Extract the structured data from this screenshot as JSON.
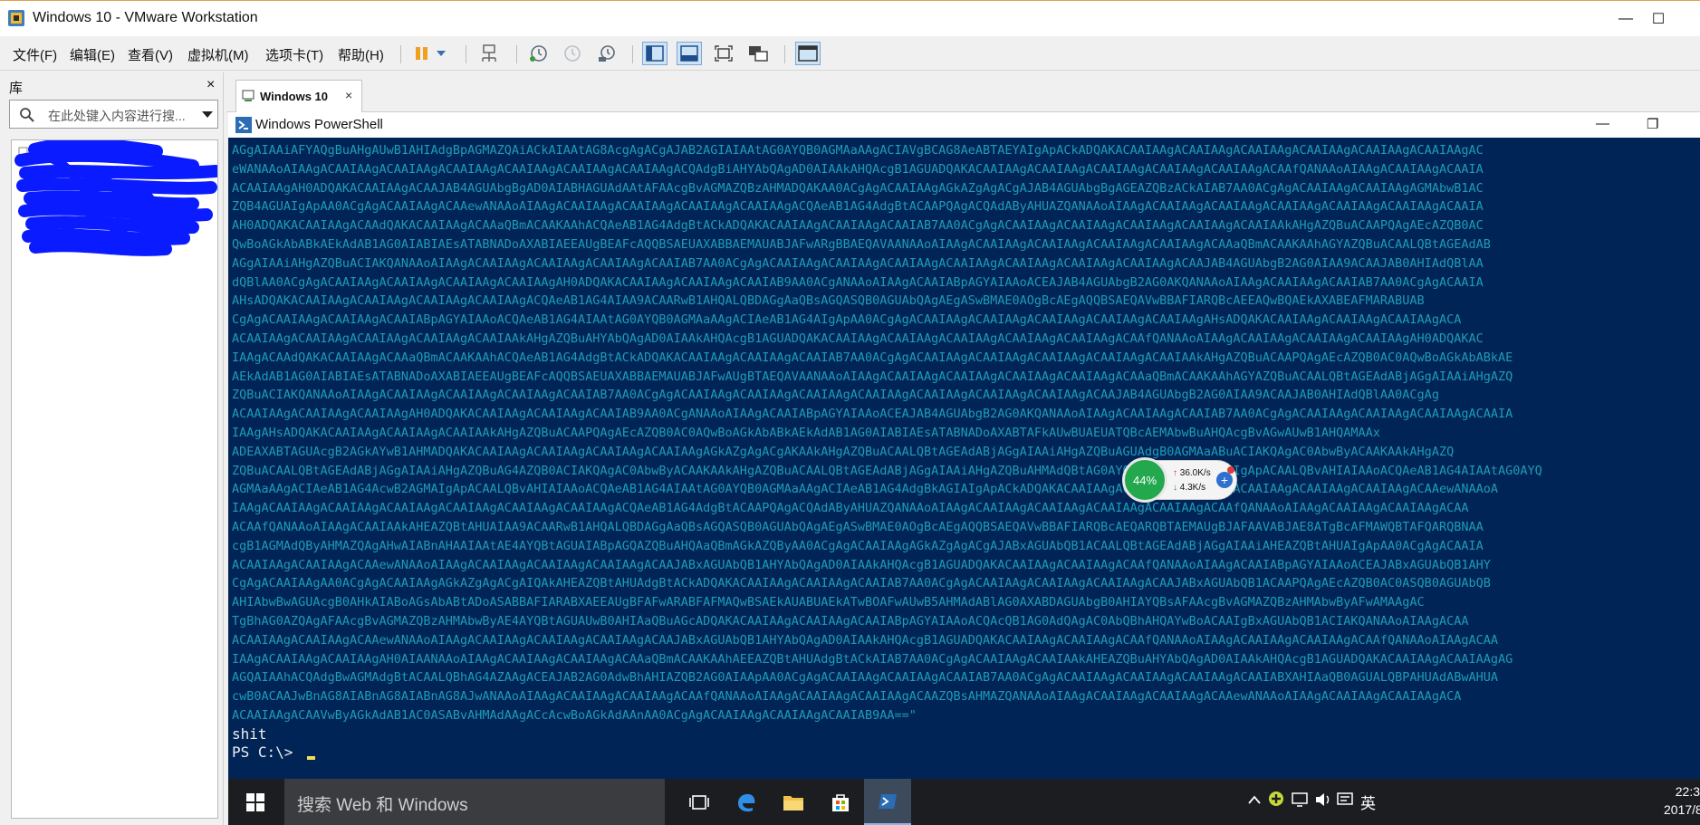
{
  "window": {
    "title": "Windows 10 - VMware Workstation",
    "minimize_glyph": "—",
    "maximize_glyph": "☐"
  },
  "menu": {
    "items": [
      "文件(F)",
      "编辑(E)",
      "查看(V)",
      "虚拟机(M)",
      "选项卡(T)",
      "帮助(H)"
    ]
  },
  "library": {
    "title": "库",
    "close_glyph": "×",
    "search_placeholder": "在此处键入内容进行搜..."
  },
  "vm_tab": {
    "label": "Windows 10",
    "close_glyph": "×"
  },
  "powershell": {
    "title": "Windows PowerShell",
    "minimize_glyph": "—",
    "restore_glyph": "❐",
    "base64_lines": [
      "AGgAIAAiAFYAQgBuAHgAUwB1AHIAdgBpAGMAZQAiACkAIAAtAG8AcgAgACgAJAB2AGIAIAAtAG0AYQB0AGMAaAAgACIAVgBCAG8AeABTAEYAIgApACkADQAKACAAIAAgACAAIAAgACAAIAAgACAAIAAgACAAIAAgACAAIAAgAC",
      "eWANAAoAIAAgACAAIAAgACAAIAAgACAAIAAgACAAIAAgACAAIAAgACAAIAAgACQAdgBiAHYAbQAgAD0AIAAkAHQAcgB1AGUADQAKACAAIAAgACAAIAAgACAAIAAgACAAIAAgACAAIAAgACAAfQANAAoAIAAgACAAIAAgACAAIA",
      "ACAAIAAgAH0ADQAKACAAIAAgACAAJAB4AGUAbgBgAD0AIABHAGUAdAAtAFAAcgBvAGMAZQBzAHMADQAKAA0ACgAgACAAIAAgAGkAZgAgACgAJAB4AGUAbgBgAGEAZQBzACkAIAB7AA0ACgAgACAAIAAgACAAIAAgAGMAbwB1AC",
      "ZQB4AGUAIgApAA0ACgAgACAAIAAgACAAewANAAoAIAAgACAAIAAgACAAIAAgACAAIAAgACAAIAAgACQAeAB1AG4AdgBtACAAPQAgACQAdAByAHUAZQANAAoAIAAgACAAIAAgACAAIAAgACAAIAAgACAAIAAgACAAIAAgACAAIA",
      "AH0ADQAKACAAIAAgACAAdQAKACAAIAAgACAAaQBmACAAKAAhACQAeAB1AG4AdgBtACkADQAKACAAIAAgACAAIAAgACAAIAB7AA0ACgAgACAAIAAgACAAIAAgACAAIAAgACAAIAAgACAAIAAkAHgAZQBuACAAPQAgAEcAZQB0AC",
      "QwBoAGkAbABkAEkAdAB1AG0AIABIAEsATABNADoAXABIAEEAUgBEAFcAQQBSAEUAXABBAEMAUABJAFwARgBBAEQAVAANAAoAIAAgACAAIAAgACAAIAAgACAAIAAgACAAIAAgACAAaQBmACAAKAAhAGYAZQBuACAALQBtAGEAdAB",
      "AGgAIAAiAHgAZQBuACIAKQANAAoAIAAgACAAIAAgACAAIAAgACAAIAAgACAAIAB7AA0ACgAgACAAIAAgACAAIAAgACAAIAAgACAAIAAgACAAIAAgACAAIAAgACAAIAAgACAAJAB4AGUAbgB2AG0AIAA9ACAAJAB0AHIAdQBlAA",
      "dQBlAA0ACgAgACAAIAAgACAAIAAgACAAIAAgACAAIAAgAH0ADQAKACAAIAAgACAAIAAgACAAIAB9AA0ACgANAAoAIAAgACAAIABpAGYAIAAoACEAJAB4AGUAbgB2AG0AKQANAAoAIAAgACAAIAAgACAAIAB7AA0ACgAgACAAIA",
      "AHsADQAKACAAIAAgACAAIAAgACAAIAAgACAAIAAgACQAeAB1AG4AIAA9ACAARwB1AHQALQBDAGgAaQBsAGQASQB0AGUAbQAgAEgASwBMAE0AOgBcAEgAQQBSAEQAVwBBAFIARQBcAEEAQwBQAEkAXABEAFMARABUAB",
      "CgAgACAAIAAgACAAIAAgACAAIABpAGYAIAAoACQAeAB1AG4AIAAtAG0AYQB0AGMAaAAgACIAeAB1AG4AIgApAA0ACgAgACAAIAAgACAAIAAgACAAIAAgACAAIAAgACAAIAAgAHsADQAKACAAIAAgACAAIAAgACAAIAAgACA",
      "ACAAIAAgACAAIAAgACAAIAAgACAAIAAgACAAIAAkAHgAZQBuAHYAbQAgAD0AIAAkAHQAcgB1AGUADQAKACAAIAAgACAAIAAgACAAIAAgACAAIAAgACAAIAAgACAAfQANAAoAIAAgACAAIAAgACAAIAAgACAAIAAgAH0ADQAKAC",
      "IAAgACAAdQAKACAAIAAgACAAaQBmACAAKAAhACQAeAB1AG4AdgBtACkADQAKACAAIAAgACAAIAAgACAAIAB7AA0ACgAgACAAIAAgACAAIAAgACAAIAAgACAAIAAgACAAIAAkAHgAZQBuACAAPQAgAEcAZQB0AC0AQwBoAGkAbABkAE",
      "AEkAdAB1AG0AIABIAEsATABNADoAXABIAEEAUgBEAFcAQQBSAEUAXABBAEMAUABJAFwAUgBTAEQAVAANAAoAIAAgACAAIAAgACAAIAAgACAAIAAgACAAIAAgACAAaQBmACAAKAAhAGYAZQBuACAALQBtAGEAdABjAGgAIAAiAHgAZQ",
      "ZQBuACIAKQANAAoAIAAgACAAIAAgACAAIAAgACAAIAAgACAAIAB7AA0ACgAgACAAIAAgACAAIAAgACAAIAAgACAAIAAgACAAIAAgACAAIAAgACAAIAAgACAAJAB4AGUAbgB2AG0AIAA9ACAAJAB0AHIAdQBlAA0ACgAg",
      "ACAAIAAgACAAIAAgACAAIAAgAH0ADQAKACAAIAAgACAAIAAgACAAIAB9AA0ACgANAAoAIAAgACAAIABpAGYAIAAoACEAJAB4AGUAbgB2AG0AKQANAAoAIAAgACAAIAAgACAAIAB7AA0ACgAgACAAIAAgACAAIAAgACAAIAAgACAAIA",
      "IAAgAHsADQAKACAAIAAgACAAIAAgACAAIAAkAHgAZQBuACAAPQAgAEcAZQB0AC0AQwBoAGkAbABkAEkAdAB1AG0AIABIAEsATABNADoAXABTAFkAUwBUAEUATQBcAEMAbwBuAHQAcgBvAGwAUwB1AHQAMAAx",
      "ADEAXABTAGUAcgB2AGkAYwB1AHMADQAKACAAIAAgACAAIAAgACAAIAAgACAAIAAgAGkAZgAgACgAKAAkAHgAZQBuACAALQBtAGEAdABjAGgAIAAiAHgAZQBuAGUAdgB0AGMAaABuACIAKQAgAC0AbwByACAAKAAkAHgAZQ",
      "ZQBuACAALQBtAGEAdABjAGgAIAAiAHgAZQBuAG4AZQB0ACIAKQAgAC0AbwByACAAKAAkAHgAZQBuACAALQBtAGEAdABjAGgAIAAiAHgAZQBuAHMAdQBtAG0AYQByAGUAbgB0ADYAIgApACAALQBvAHIAIAAoACQAeAB1AG4AIAAtAG0AYQ",
      "AGMAaAAgACIAeAB1AG4AcwB2AGMAIgApACAALQBvAHIAIAAoACQAeAB1AG4AIAAtAG0AYQB0AGMAaAAgACIAeAB1AG4AdgBkAGIAIgApACkADQAKACAAIAAgACAAIAAgACAAIAAgACAAIAAgACAAIAAgACAAIAAgACAAewANAAoA",
      "IAAgACAAIAAgACAAIAAgACAAIAAgACAAIAAgACAAIAAgACAAIAAgACQAeAB1AG4AdgBtACAAPQAgACQAdAByAHUAZQANAAoAIAAgACAAIAAgACAAIAAgACAAIAAgACAAIAAgACAAfQANAAoAIAAgACAAIAAgACAAIAAgACAA",
      "ACAAfQANAAoAIAAgACAAIAAkAHEAZQBtAHUAIAA9ACAARwB1AHQALQBDAGgAaQBsAGQASQB0AGUAbQAgAEgASwBMAE0AOgBcAEgAQQBSAEQAVwBBAFIARQBcAEQARQBTAEMAUgBJAFAAVABJAE8ATgBcAFMAWQBTAFQARQBNAA",
      "cgB1AGMAdQByAHMAZQAgAHwAIABnAHAAIAAtAE4AYQBtAGUAIABpAGQAZQBuAHQAaQBmAGkAZQByAA0ACgAgACAAIAAgAGkAZgAgACgAJABxAGUAbQB1ACAALQBtAGEAdABjAGgAIAAiAHEAZQBtAHUAIgApAA0ACgAgACAAIA",
      "ACAAIAAgACAAIAAgACAAewANAAoAIAAgACAAIAAgACAAIAAgACAAIAAgACAAJABxAGUAbQB1AHYAbQAgAD0AIAAkAHQAcgB1AGUADQAKACAAIAAgACAAIAAgACAAfQANAAoAIAAgACAAIABpAGYAIAAoACEAJABxAGUAbQB1AHY",
      "CgAgACAAIAAgAA0ACgAgACAAIAAgAGkAZgAgACgAIQAkAHEAZQBtAHUAdgBtACkADQAKACAAIAAgACAAIAAgACAAIAB7AA0ACgAgACAAIAAgACAAIAAgACAAIAAgACAAJABxAGUAbQB1ACAAPQAgAEcAZQB0AC0ASQB0AGUAbQB",
      "AHIAbwBwAGUAcgB0AHkAIABoAGsAbABtADoASABBAFIARABXAEEAUgBFAFwARABFAFMAQwBSAEkAUABUAEkATwBOAFwAUwB5AHMAdABlAG0AXABDAGUAbgB0AHIAYQBsAFAAcgBvAGMAZQBzAHMAbwByAFwAMAAgAC",
      "TgBhAG0AZQAgAFAAcgBvAGMAZQBzAHMAbwByAE4AYQBtAGUAUwB0AHIAaQBuAGcADQAKACAAIAAgACAAIAAgACAAIABpAGYAIAAoACQAcQB1AG0AdQAgAC0AbQBhAHQAYwBoACAAIgBxAGUAbQB1ACIAKQANAAoAIAAgACAA",
      "ACAAIAAgACAAIAAgACAAewANAAoAIAAgACAAIAAgACAAIAAgACAAIAAgACAAJABxAGUAbQB1AHYAbQAgAD0AIAAkAHQAcgB1AGUADQAKACAAIAAgACAAIAAgACAAfQANAAoAIAAgACAAIAAgACAAIAAgACAAfQANAAoAIAAgACAA",
      "IAAgACAAIAAgACAAIAAgAH0AIAANAAoAIAAgACAAIAAgACAAIAAgACAAaQBmACAAKAAhAEEAZQBtAHUAdgBtACkAIAB7AA0ACgAgACAAIAAgACAAIAAkAHEAZQBuAHYAbQAgAD0AIAAkAHQAcgB1AGUADQAKACAAIAAgACAAIAAgAG",
      "AGQAIAAhACQAdgBwAGMAdgBtACAALQBhAG4AZAAgACEAJAB2AG0AdwBhAHIAZQB2AG0AIAApAA0ACgAgACAAIAAgACAAIAAgACAAIAB7AA0ACgAgACAAIAAgACAAIAAgACAAIAAgACAAIABXAHIAaQB0AGUALQBPAHUAdABwAHUA",
      "cwB0ACAAJwBnAG8AIABnAG8AIABnAG8AJwANAAoAIAAgACAAIAAgACAAIAAgACAAfQANAAoAIAAgACAAIAAgACAAIAAgACAAZQBsAHMAZQANAAoAIAAgACAAIAAgACAAIAAgACAAewANAAoAIAAgACAAIAAgACAAIAAgACA",
      "ACAAIAAgACAAVwByAGkAdAB1AC0ASABvAHMAdAAgACcAcwBoAGkAdAAnAA0ACgAgACAAIAAgACAAIAAgACAAIAB9AA==\""
    ],
    "output_line": "shit",
    "prompt": "PS C:\\> "
  },
  "net_widget": {
    "cpu_percent": "44%",
    "upload": "36.0K/s",
    "download": "4.3K/s",
    "up_arrow": "↑",
    "down_arrow": "↓",
    "plus_glyph": "+"
  },
  "taskbar": {
    "search_placeholder": "搜索 Web 和 Windows",
    "ime_label": "英",
    "time": "22:3",
    "date": "2017/8"
  },
  "colors": {
    "ps_background": "#012456",
    "base64_text": "#1d9cb8",
    "console_text": "#eeedf0",
    "scribble": "#0a1cff",
    "gauge_green": "#23a84e"
  }
}
